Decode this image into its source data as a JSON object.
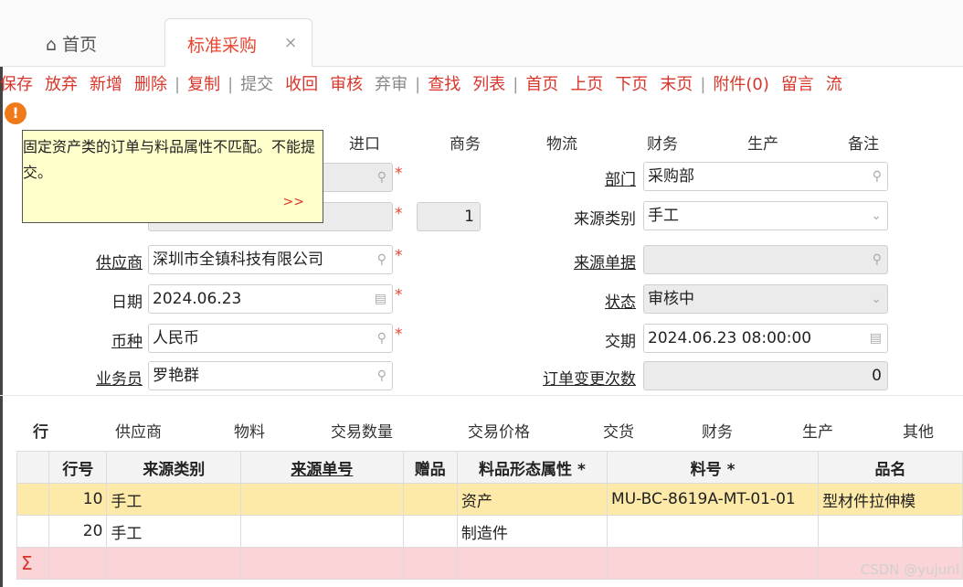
{
  "tabs": {
    "home": "首页",
    "active": "标准采购",
    "close": "×"
  },
  "toolbar": [
    "保存",
    "放弃",
    "新增",
    "删除",
    "|",
    "复制",
    "|",
    "提交",
    "收回",
    "审核",
    "弃审",
    "|",
    "查找",
    "列表",
    "|",
    "首页",
    "上页",
    "下页",
    "末页",
    "|",
    "附件(0)",
    "留言",
    "流"
  ],
  "toolbar_disabled": [
    "提交",
    "弃审"
  ],
  "alert": {
    "icon": "!",
    "message": "固定资产类的订单与料品属性不匹配。不能提交。",
    "more": ">>"
  },
  "subtabs": [
    "进口",
    "商务",
    "物流",
    "财务",
    "生产",
    "备注"
  ],
  "form": {
    "qty_value": "1",
    "dept_label": "部门",
    "dept_value": "采购部",
    "source_type_label": "来源类别",
    "source_type_value": "手工",
    "supplier_label": "供应商",
    "supplier_value": "深圳市全镇科技有限公司",
    "source_no_label": "来源单据",
    "source_no_value": "",
    "date_label": "日期",
    "date_value": "2024.06.23",
    "status_label": "状态",
    "status_value": "审核中",
    "currency_label": "币种",
    "currency_value": "人民币",
    "delivery_label": "交期",
    "delivery_value": "2024.06.23 08:00:00",
    "staff_label": "业务员",
    "staff_value": "罗艳群",
    "change_label": "订单变更次数",
    "change_value": "0",
    "required": "*"
  },
  "bottom_tabs": [
    "行",
    "供应商",
    "物料",
    "交易数量",
    "交易价格",
    "交货",
    "财务",
    "生产",
    "其他"
  ],
  "grid": {
    "headers": [
      "行号",
      "来源类别",
      "来源单号",
      "赠品",
      "料品形态属性 *",
      "料号 *",
      "品名"
    ],
    "rows": [
      [
        "10",
        "手工",
        "",
        "",
        "资产",
        "MU-BC-8619A-MT-01-01",
        "型材件拉伸模"
      ],
      [
        "20",
        "手工",
        "",
        "",
        "制造件",
        "",
        ""
      ]
    ],
    "sum_symbol": "Σ"
  },
  "watermark": "CSDN @yujunl"
}
